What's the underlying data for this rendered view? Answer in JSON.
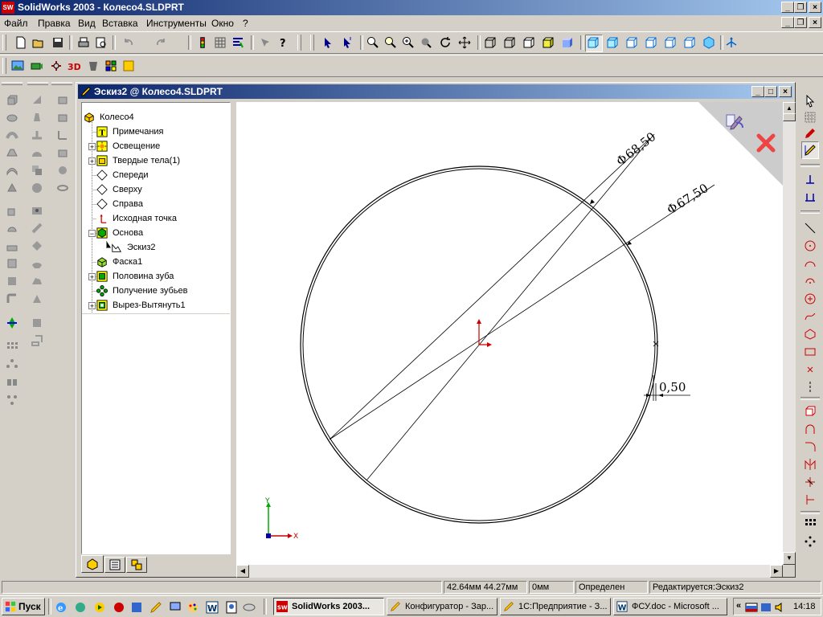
{
  "app": {
    "title": "SolidWorks 2003 - Колесо4.SLDPRT",
    "logo_text": "SW"
  },
  "menu": [
    "Файл",
    "Правка",
    "Вид",
    "Вставка",
    "Инструменты",
    "Окно",
    "?"
  ],
  "document": {
    "title": "Эскиз2 @ Колесо4.SLDPRT",
    "tree": [
      {
        "label": "Колесо4",
        "icon": "part-icon",
        "level": 0
      },
      {
        "label": "Примечания",
        "icon": "annotations-icon",
        "level": 1
      },
      {
        "label": "Освещение",
        "icon": "lighting-icon",
        "level": 1,
        "expandable": true
      },
      {
        "label": "Твердые тела(1)",
        "icon": "solid-bodies-icon",
        "level": 1,
        "expandable": true
      },
      {
        "label": "Спереди",
        "icon": "plane-icon",
        "level": 1
      },
      {
        "label": "Сверху",
        "icon": "plane-icon",
        "level": 1
      },
      {
        "label": "Справа",
        "icon": "plane-icon",
        "level": 1
      },
      {
        "label": "Исходная точка",
        "icon": "origin-icon",
        "level": 1
      },
      {
        "label": "Основа",
        "icon": "base-feature-icon",
        "level": 1,
        "expanded": true
      },
      {
        "label": "Эскиз2",
        "icon": "sketch-icon",
        "level": 2
      },
      {
        "label": "Фаска1",
        "icon": "chamfer-icon",
        "level": 1
      },
      {
        "label": "Половина зуба",
        "icon": "feature-icon",
        "level": 1,
        "expandable": true
      },
      {
        "label": "Получение зубьев",
        "icon": "pattern-icon",
        "level": 1
      },
      {
        "label": "Вырез-Вытянуть1",
        "icon": "cut-extrude-icon",
        "level": 1,
        "expandable": true
      }
    ],
    "dimensions": {
      "dia_outer": "68,50",
      "dia_inner": "67,50",
      "gap": "0,50",
      "dia_symbol": "Φ"
    },
    "axes": {
      "x": "X",
      "y": "Y"
    }
  },
  "statusbar": {
    "coords": "42.64мм 44.27мм",
    "z": "0мм",
    "state": "Определен",
    "editing": "Редактируется:Эскиз2"
  },
  "taskbar": {
    "start": "Пуск",
    "tasks": [
      {
        "label": "SolidWorks 2003...",
        "active": true
      },
      {
        "label": "Конфигуратор - Зар..."
      },
      {
        "label": "1С:Предприятие - З..."
      },
      {
        "label": "ФСУ.doc - Microsoft ..."
      }
    ],
    "tray_chevron": "«",
    "clock": "14:18"
  },
  "colors": {
    "title_start": "#0a246a",
    "title_end": "#a6caf0",
    "face": "#d4d0c8"
  }
}
